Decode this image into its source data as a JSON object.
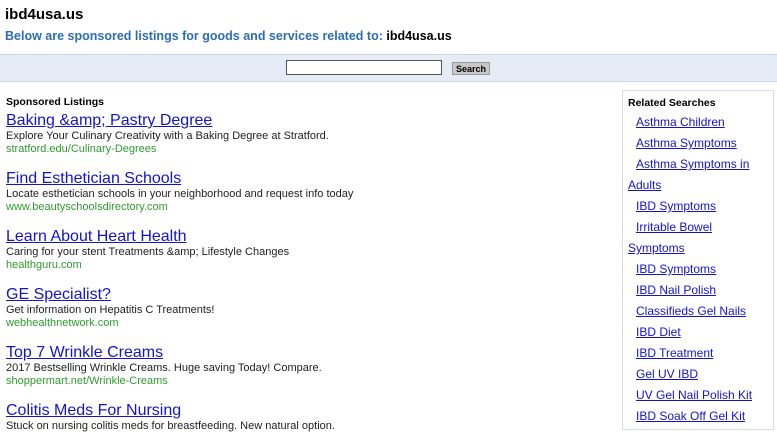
{
  "header": {
    "site_title": "ibd4usa.us",
    "subtitle_prefix": "Below are sponsored listings for goods and services related to:",
    "subtitle_domain": "ibd4usa.us"
  },
  "search": {
    "value": "",
    "button_label": "Search"
  },
  "main": {
    "section_label": "Sponsored Listings",
    "listings": [
      {
        "title": "Baking &amp; Pastry Degree",
        "desc": "Explore Your Culinary Creativity with a Baking Degree at Stratford.",
        "url": "stratford.edu/Culinary-Degrees"
      },
      {
        "title": "Find Esthetician Schools",
        "desc": "Locate esthetician schools in your neighborhood and request info today",
        "url": "www.beautyschoolsdirectory.com"
      },
      {
        "title": "Learn About Heart Health",
        "desc": "Caring for your stent Treatments &amp; Lifestyle Changes",
        "url": "healthguru.com"
      },
      {
        "title": "GE Specialist?",
        "desc": "Get information on Hepatitis C Treatments!",
        "url": "webhealthnetwork.com"
      },
      {
        "title": "Top 7 Wrinkle Creams",
        "desc": "2017 Bestselling Wrinkle Creams. Huge saving Today! Compare.",
        "url": "shoppermart.net/Wrinkle-Creams"
      },
      {
        "title": "Colitis Meds For Nursing",
        "desc": "Stuck on nursing colitis meds for breastfeeding. New natural option.",
        "url": ""
      }
    ]
  },
  "sidebar": {
    "heading": "Related Searches",
    "lines": [
      {
        "text": "Asthma Children",
        "cont": false
      },
      {
        "text": "Asthma Symptoms",
        "cont": false
      },
      {
        "text": "Asthma Symptoms in",
        "cont": false
      },
      {
        "text": "Adults",
        "cont": true
      },
      {
        "text": "IBD Symptoms",
        "cont": false
      },
      {
        "text": "Irritable Bowel",
        "cont": false
      },
      {
        "text": "Symptoms",
        "cont": true
      },
      {
        "text": "IBD Symptoms",
        "cont": false
      },
      {
        "text": "IBD Nail Polish",
        "cont": false
      },
      {
        "text": "Classifieds Gel Nails",
        "cont": false
      },
      {
        "text": "IBD Diet",
        "cont": false
      },
      {
        "text": "IBD Treatment",
        "cont": false
      },
      {
        "text": "Gel UV IBD",
        "cont": false
      },
      {
        "text": "UV Gel Nail Polish Kit",
        "cont": false
      },
      {
        "text": "IBD Soak Off Gel Kit",
        "cont": false
      }
    ]
  },
  "colors": {
    "link": "#1414c8",
    "url_green": "#2e9b2e",
    "subtitle_blue": "#2c6db3",
    "search_bar_bg": "#e6ecf5"
  }
}
